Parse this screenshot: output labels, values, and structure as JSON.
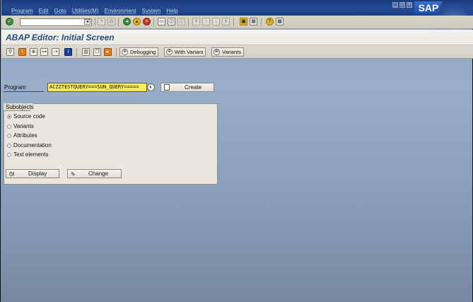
{
  "menubar": {
    "items": [
      "Program",
      "Edit",
      "Goto",
      "Utilities(M)",
      "Environment",
      "System",
      "Help"
    ],
    "logo": "SAP"
  },
  "systoolbar": {
    "command_field_value": "",
    "icons": [
      "enter-icon",
      "save-icon",
      "back-icon",
      "exit-icon",
      "cancel-icon",
      "print-icon",
      "find-icon",
      "find-next-icon",
      "first-page-icon",
      "previous-page-icon",
      "next-page-icon",
      "last-page-icon",
      "create-session-icon",
      "shortcut-icon",
      "help-icon",
      "layout-menu-icon"
    ]
  },
  "title": "ABAP Editor: Initial Screen",
  "apptoolbar": {
    "buttons": [
      {
        "label": "Debugging"
      },
      {
        "label": "With Variant"
      },
      {
        "label": "Variants"
      }
    ]
  },
  "program": {
    "label": "Program",
    "value": "ACZZTESTQUERY===SUN_QUERY=====",
    "create_label": "Create"
  },
  "subobjects": {
    "title": "Subobjects",
    "options": [
      {
        "label": "Source code",
        "selected": true
      },
      {
        "label": "Variants",
        "selected": false
      },
      {
        "label": "Attributes",
        "selected": false
      },
      {
        "label": "Documentation",
        "selected": false
      },
      {
        "label": "Text elements",
        "selected": false
      }
    ],
    "display_label": "Display",
    "change_label": "Change"
  },
  "colors": {
    "menubar": "#234b93",
    "background": "#8ea4c2",
    "title_text": "#2a4b7c",
    "input_highlight": "#f6ea62"
  }
}
